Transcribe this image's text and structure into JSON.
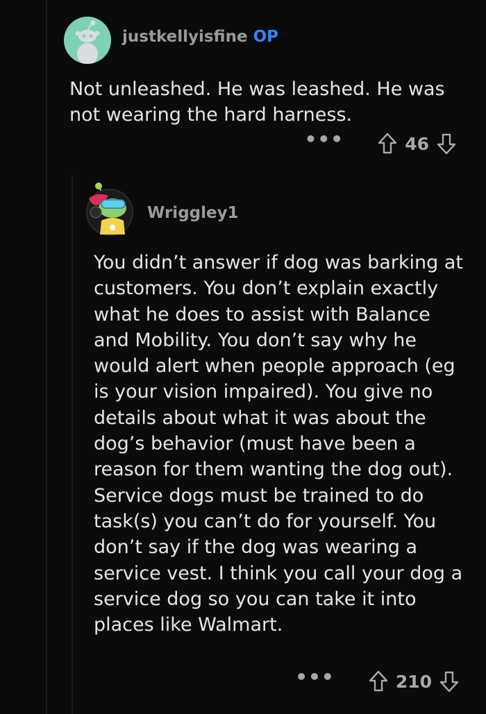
{
  "comments": [
    {
      "username": "justkellyisfine",
      "op_badge": "OP",
      "body": "Not unleashed.  He was leashed.  He was not wearing the hard harness.",
      "score": "46",
      "more_label": "•••",
      "avatar_color": "#7fd1b4",
      "avatar_icon": "snoo-avatar-icon"
    },
    {
      "username": "Wriggley1",
      "body": "You didn’t answer if dog was barking at customers. You don’t explain exactly what he does to assist with Balance and Mobility. You don’t say why he would alert when people approach (eg is your vision impaired). You give no details about what it was about the dog’s behavior (must have been a reason for them wanting the dog out). Service dogs must be trained to do task(s) you can’t do for yourself. You don’t say if the dog was wearing a service vest. I think you call your dog a service dog so you can take it into places like Walmart.",
      "score": "210",
      "more_label": "•••",
      "avatar_icon": "snoo-custom-avatar-icon"
    }
  ],
  "theme": {
    "background": "#0b0b0b",
    "text": "#e6e6e6",
    "muted": "#9a9a9a",
    "op_color": "#3b82f6"
  }
}
